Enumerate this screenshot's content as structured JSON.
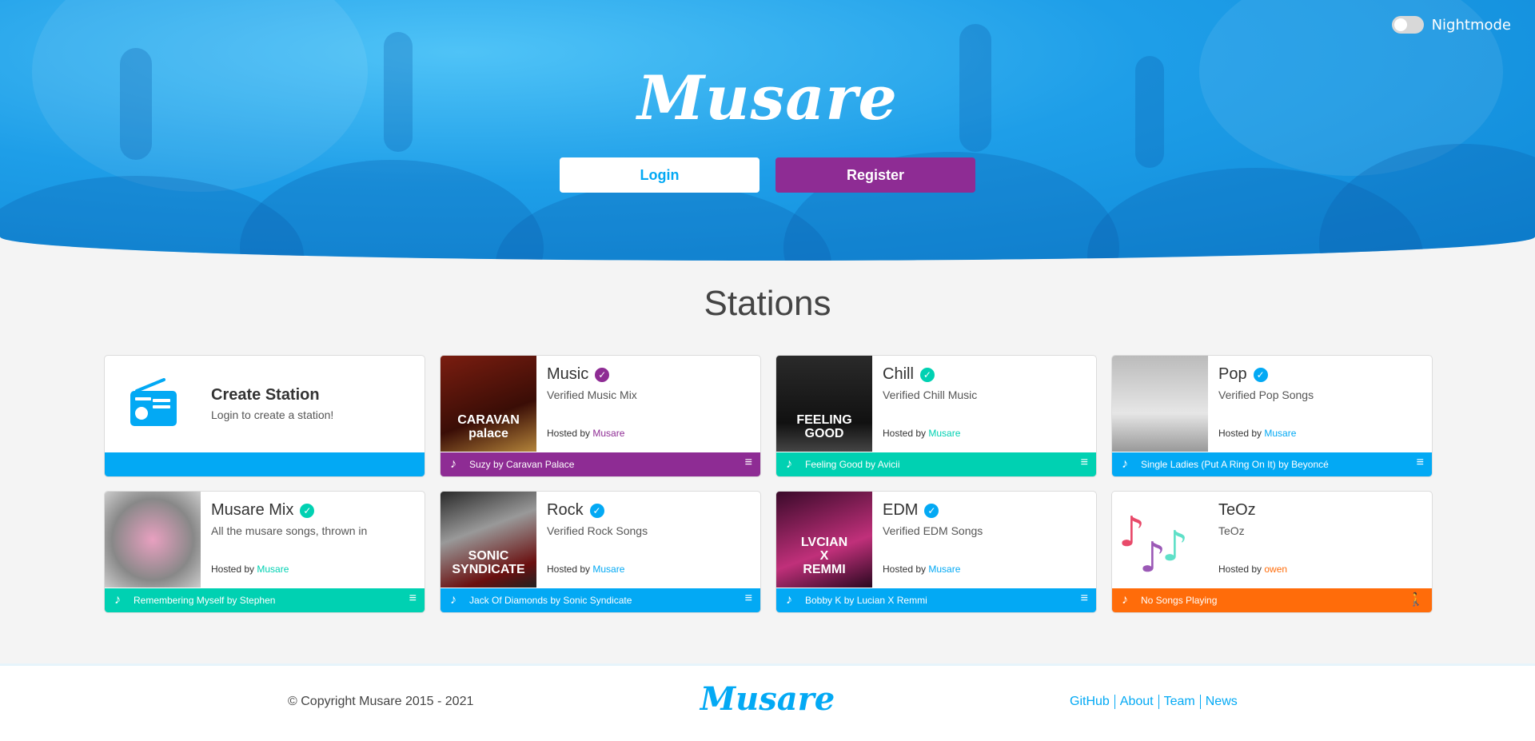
{
  "colors": {
    "brand": "#03a9f4",
    "purple": "#8e2c94",
    "teal": "#00d1b2",
    "blue": "#03a9f4",
    "orange": "#ff6c0a"
  },
  "header": {
    "logo": "Musare",
    "nightmode_label": "Nightmode",
    "login_label": "Login",
    "register_label": "Register"
  },
  "stations_heading": "Stations",
  "create_station": {
    "title": "Create Station",
    "desc": "Login to create a station!"
  },
  "hosted_by_label": "Hosted by",
  "stations": [
    {
      "name": "Music",
      "desc": "Verified Music Mix",
      "host": "Musare",
      "now_playing": "Suzy by Caravan Palace",
      "bar_color": "#8e2c94",
      "verified": true,
      "art_text": "CARAVAN\npalace"
    },
    {
      "name": "Chill",
      "desc": "Verified Chill Music",
      "host": "Musare",
      "now_playing": "Feeling Good by Avicii",
      "bar_color": "#00d1b2",
      "verified": true,
      "art_text": "FEELING\nGOOD"
    },
    {
      "name": "Pop",
      "desc": "Verified Pop Songs",
      "host": "Musare",
      "now_playing": "Single Ladies (Put A Ring On It) by Beyoncé",
      "bar_color": "#03a9f4",
      "verified": true,
      "art_text": ""
    },
    {
      "name": "Musare Mix",
      "desc": "All the musare songs, thrown in",
      "host": "Musare",
      "now_playing": "Remembering Myself by Stephen",
      "bar_color": "#00d1b2",
      "verified": true,
      "art_text": ""
    },
    {
      "name": "Rock",
      "desc": "Verified Rock Songs",
      "host": "Musare",
      "now_playing": "Jack Of Diamonds by Sonic Syndicate",
      "bar_color": "#03a9f4",
      "verified": true,
      "art_text": "SONIC SYNDICATE"
    },
    {
      "name": "EDM",
      "desc": "Verified EDM Songs",
      "host": "Musare",
      "now_playing": "Bobby K by Lucian X Remmi",
      "bar_color": "#03a9f4",
      "verified": true,
      "art_text": "LVCIAN\nX\nREMMI"
    },
    {
      "name": "TeOz",
      "desc": "TeOz",
      "host": "owen",
      "now_playing": "No Songs Playing",
      "bar_color": "#ff6c0a",
      "verified": false,
      "art_text": ""
    }
  ],
  "footer": {
    "copyright": "© Copyright Musare 2015 - 2021",
    "logo": "Musare",
    "links": [
      "GitHub",
      "About",
      "Team",
      "News"
    ]
  }
}
